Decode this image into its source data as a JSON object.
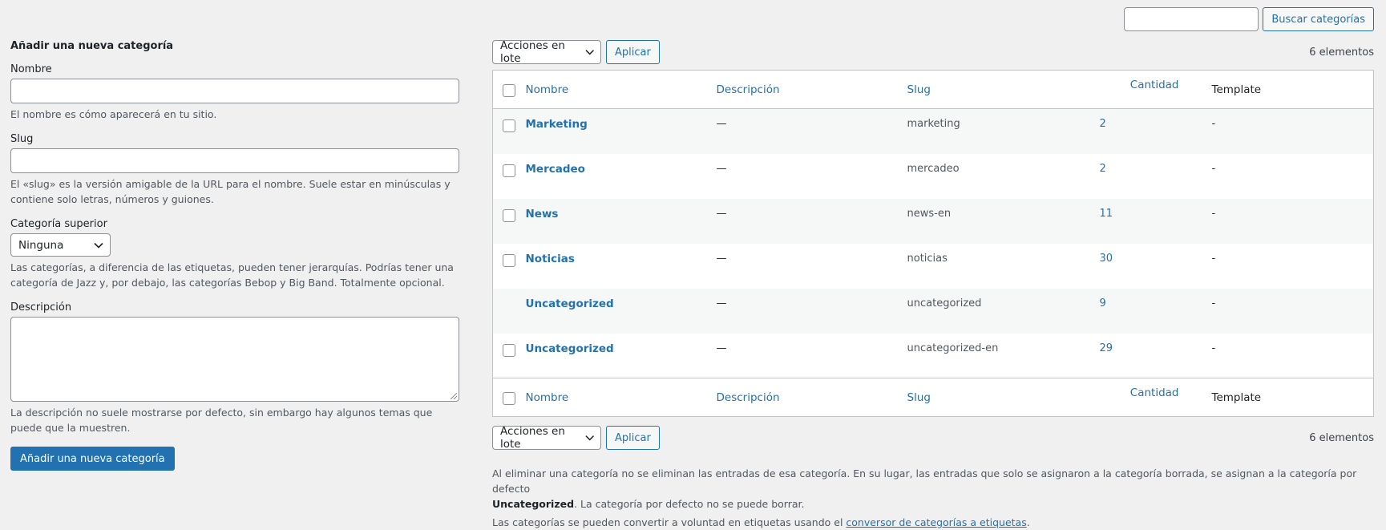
{
  "search": {
    "placeholder": "",
    "button": "Buscar categorías"
  },
  "form": {
    "heading": "Añadir una nueva categoría",
    "name_label": "Nombre",
    "name_help": "El nombre es cómo aparecerá en tu sitio.",
    "slug_label": "Slug",
    "slug_help": "El «slug» es la versión amigable de la URL para el nombre. Suele estar en minúsculas y contiene solo letras, números y guiones.",
    "parent_label": "Categoría superior",
    "parent_value": "Ninguna",
    "parent_help": "Las categorías, a diferencia de las etiquetas, pueden tener jerarquías. Podrías tener una categoría de Jazz y, por debajo, las categorías Bebop y Big Band. Totalmente opcional.",
    "desc_label": "Descripción",
    "desc_help": "La descripción no suele mostrarse por defecto, sin embargo hay algunos temas que puede que la muestren.",
    "submit": "Añadir una nueva categoría"
  },
  "tablenav": {
    "bulk_label": "Acciones en lote",
    "apply": "Aplicar",
    "count": "6 elementos"
  },
  "columns": {
    "name": "Nombre",
    "description": "Descripción",
    "slug": "Slug",
    "count": "Cantidad",
    "template": "Template"
  },
  "rows": [
    {
      "name": "Marketing",
      "description": "—",
      "slug": "marketing",
      "count": "2",
      "template": "-",
      "checkbox": true
    },
    {
      "name": "Mercadeo",
      "description": "—",
      "slug": "mercadeo",
      "count": "2",
      "template": "-",
      "checkbox": true
    },
    {
      "name": "News",
      "description": "—",
      "slug": "news-en",
      "count": "11",
      "template": "-",
      "checkbox": true
    },
    {
      "name": "Noticias",
      "description": "—",
      "slug": "noticias",
      "count": "30",
      "template": "-",
      "checkbox": true
    },
    {
      "name": "Uncategorized",
      "description": "—",
      "slug": "uncategorized",
      "count": "9",
      "template": "-",
      "checkbox": false
    },
    {
      "name": "Uncategorized",
      "description": "—",
      "slug": "uncategorized-en",
      "count": "29",
      "template": "-",
      "checkbox": true
    }
  ],
  "notes": {
    "line1": "Al eliminar una categoría no se eliminan las entradas de esa categoría. En su lugar, las entradas que solo se asignaron a la categoría borrada, se asignan a la categoría por defecto",
    "default_cat": "Uncategorized",
    "line1_end": ". La categoría por defecto no se puede borrar.",
    "line2": "Las categorías se pueden convertir a voluntad en etiquetas usando el",
    "line2_link": "conversor de categorías a etiquetas",
    "line2_end": "."
  }
}
